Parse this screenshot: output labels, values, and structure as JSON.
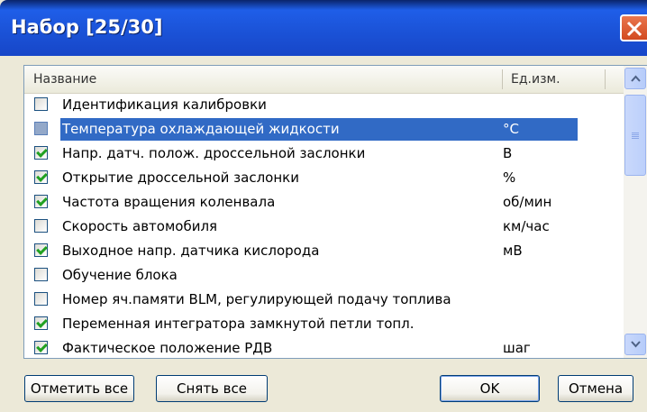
{
  "window": {
    "title": "Набор [25/30]"
  },
  "list": {
    "columns": {
      "name": "Название",
      "unit": "Ед.изм."
    },
    "rows": [
      {
        "name": "Идентификация калибровки",
        "unit": "",
        "checked": false,
        "selected": false
      },
      {
        "name": "Температура охлаждающей жидкости",
        "unit": "°C",
        "checked": false,
        "selected": true
      },
      {
        "name": "Напр. датч. полож. дроссельной заслонки",
        "unit": "В",
        "checked": true,
        "selected": false
      },
      {
        "name": "Открытие дроссельной заслонки",
        "unit": "%",
        "checked": true,
        "selected": false
      },
      {
        "name": "Частота вращения коленвала",
        "unit": "об/мин",
        "checked": true,
        "selected": false
      },
      {
        "name": "Скорость автомобиля",
        "unit": "км/час",
        "checked": false,
        "selected": false
      },
      {
        "name": "Выходное напр. датчика кислорода",
        "unit": "мВ",
        "checked": true,
        "selected": false
      },
      {
        "name": "Обучение блока",
        "unit": "",
        "checked": false,
        "selected": false
      },
      {
        "name": "Номер яч.памяти BLM, регулирующей подачу топлива",
        "unit": "",
        "checked": false,
        "selected": false
      },
      {
        "name": "Переменная интегратора замкнутой петли топл.",
        "unit": "",
        "checked": true,
        "selected": false
      },
      {
        "name": "Фактическое положение РДВ",
        "unit": "шаг",
        "checked": true,
        "selected": false
      }
    ]
  },
  "buttons": {
    "check_all": "Отметить все",
    "uncheck_all": "Снять все",
    "ok": "OK",
    "cancel": "Отмена"
  },
  "colors": {
    "title_bar": "#1f5ee8",
    "selection": "#316ac5",
    "close_button": "#d24a1f"
  }
}
